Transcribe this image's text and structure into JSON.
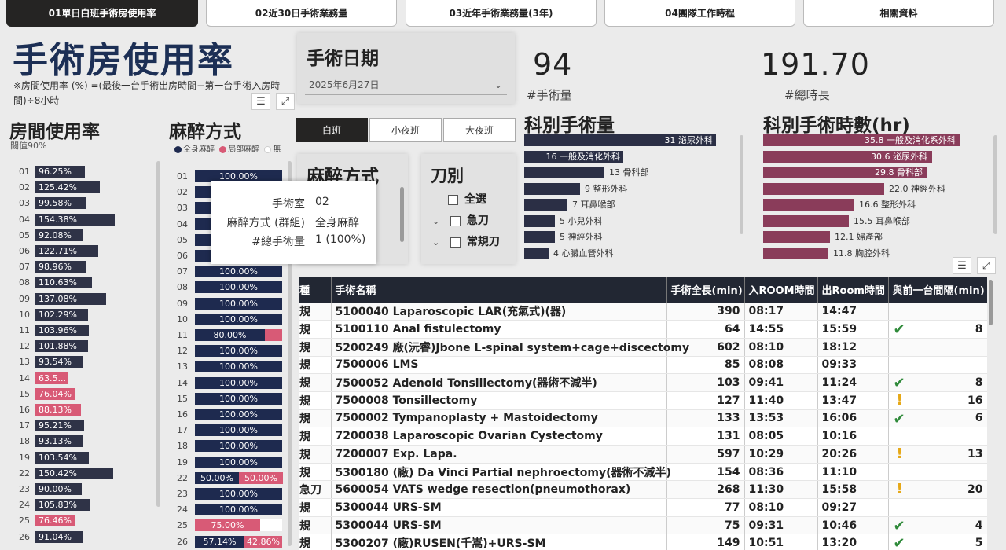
{
  "tabs": [
    {
      "label": "01單日白班手術房使用率",
      "active": true
    },
    {
      "label": "02近30日手術業務量",
      "active": false
    },
    {
      "label": "03近年手術業務量(3年)",
      "active": false
    },
    {
      "label": "04團隊工作時程",
      "active": false
    },
    {
      "label": "相關資料",
      "active": false
    }
  ],
  "page_title": "手術房使用率",
  "formula_note": "※房間使用率 (%) =(最後一台手術出房時間−第一台手術入房時間)÷8小時",
  "room_usage": {
    "title": "房間使用率",
    "threshold": "閾值90%",
    "rows": [
      {
        "room": "01",
        "value": "96.25%",
        "pct": 96.25
      },
      {
        "room": "02",
        "value": "125.42%",
        "pct": 125.42
      },
      {
        "room": "03",
        "value": "99.58%",
        "pct": 99.58
      },
      {
        "room": "04",
        "value": "154.38%",
        "pct": 154.38
      },
      {
        "room": "05",
        "value": "92.08%",
        "pct": 92.08
      },
      {
        "room": "06",
        "value": "122.71%",
        "pct": 122.71
      },
      {
        "room": "07",
        "value": "98.96%",
        "pct": 98.96
      },
      {
        "room": "08",
        "value": "110.63%",
        "pct": 110.63
      },
      {
        "room": "09",
        "value": "137.08%",
        "pct": 137.08
      },
      {
        "room": "10",
        "value": "102.29%",
        "pct": 102.29
      },
      {
        "room": "11",
        "value": "103.96%",
        "pct": 103.96
      },
      {
        "room": "12",
        "value": "101.88%",
        "pct": 101.88
      },
      {
        "room": "13",
        "value": "93.54%",
        "pct": 93.54
      },
      {
        "room": "14",
        "value": "63.5...",
        "pct": 63.5
      },
      {
        "room": "15",
        "value": "76.04%",
        "pct": 76.04
      },
      {
        "room": "16",
        "value": "88.13%",
        "pct": 88.13
      },
      {
        "room": "17",
        "value": "95.21%",
        "pct": 95.21
      },
      {
        "room": "18",
        "value": "93.13%",
        "pct": 93.13
      },
      {
        "room": "19",
        "value": "103.54%",
        "pct": 103.54
      },
      {
        "room": "22",
        "value": "150.42%",
        "pct": 150.42
      },
      {
        "room": "23",
        "value": "90.00%",
        "pct": 90.0
      },
      {
        "room": "24",
        "value": "105.83%",
        "pct": 105.83
      },
      {
        "room": "25",
        "value": "76.46%",
        "pct": 76.46
      },
      {
        "room": "26",
        "value": "91.04%",
        "pct": 91.04
      }
    ]
  },
  "anesthesia": {
    "title": "麻醉方式",
    "legend": [
      {
        "label": "全身麻醉",
        "color": "#1e2a4f"
      },
      {
        "label": "局部麻醉",
        "color": "#d85a76"
      },
      {
        "label": "無",
        "color": "#ffffff"
      }
    ],
    "rows": [
      {
        "room": "01",
        "general": 100,
        "local": 0,
        "general_label": "100.00%",
        "local_label": ""
      },
      {
        "room": "02",
        "general": 100,
        "local": 0,
        "general_label": "100.00%",
        "local_label": ""
      },
      {
        "room": "03",
        "general": 100,
        "local": 0,
        "general_label": "100.00%",
        "local_label": ""
      },
      {
        "room": "04",
        "general": 100,
        "local": 0,
        "general_label": "100.00%",
        "local_label": ""
      },
      {
        "room": "05",
        "general": 100,
        "local": 0,
        "general_label": "100.00%",
        "local_label": ""
      },
      {
        "room": "06",
        "general": 100,
        "local": 0,
        "general_label": "100.00%",
        "local_label": ""
      },
      {
        "room": "07",
        "general": 100,
        "local": 0,
        "general_label": "100.00%",
        "local_label": ""
      },
      {
        "room": "08",
        "general": 100,
        "local": 0,
        "general_label": "100.00%",
        "local_label": ""
      },
      {
        "room": "09",
        "general": 100,
        "local": 0,
        "general_label": "100.00%",
        "local_label": ""
      },
      {
        "room": "10",
        "general": 100,
        "local": 0,
        "general_label": "100.00%",
        "local_label": ""
      },
      {
        "room": "11",
        "general": 80,
        "local": 20,
        "general_label": "80.00%",
        "local_label": ""
      },
      {
        "room": "12",
        "general": 100,
        "local": 0,
        "general_label": "100.00%",
        "local_label": ""
      },
      {
        "room": "13",
        "general": 100,
        "local": 0,
        "general_label": "100.00%",
        "local_label": ""
      },
      {
        "room": "14",
        "general": 100,
        "local": 0,
        "general_label": "100.00%",
        "local_label": ""
      },
      {
        "room": "15",
        "general": 100,
        "local": 0,
        "general_label": "100.00%",
        "local_label": ""
      },
      {
        "room": "16",
        "general": 100,
        "local": 0,
        "general_label": "100.00%",
        "local_label": ""
      },
      {
        "room": "17",
        "general": 100,
        "local": 0,
        "general_label": "100.00%",
        "local_label": ""
      },
      {
        "room": "18",
        "general": 100,
        "local": 0,
        "general_label": "100.00%",
        "local_label": ""
      },
      {
        "room": "19",
        "general": 100,
        "local": 0,
        "general_label": "100.00%",
        "local_label": ""
      },
      {
        "room": "22",
        "general": 50,
        "local": 50,
        "general_label": "50.00%",
        "local_label": "50.00%"
      },
      {
        "room": "23",
        "general": 100,
        "local": 0,
        "general_label": "100.00%",
        "local_label": ""
      },
      {
        "room": "24",
        "general": 100,
        "local": 0,
        "general_label": "100.00%",
        "local_label": ""
      },
      {
        "room": "25",
        "general": 0,
        "local": 75,
        "general_label": "",
        "local_label": "75.00%"
      },
      {
        "room": "26",
        "general": 57.14,
        "local": 42.86,
        "general_label": "57.14%",
        "local_label": "42.86%"
      }
    ]
  },
  "tooltip": {
    "rows": [
      {
        "key": "手術室",
        "value": "02"
      },
      {
        "key": "麻醉方式 (群組)",
        "value": "全身麻醉"
      },
      {
        "key": "#總手術量",
        "value": "1 (100%)"
      }
    ]
  },
  "date_filter": {
    "title": "手術日期",
    "value": "2025年6月27日"
  },
  "shift_buttons": [
    {
      "label": "白班",
      "active": true
    },
    {
      "label": "小夜班",
      "active": false
    },
    {
      "label": "大夜班",
      "active": false
    }
  ],
  "anesthesia_filter": {
    "title": "麻醉方式"
  },
  "knife_filter": {
    "title": "刀別",
    "options": [
      "全選",
      "急刀",
      "常規刀"
    ]
  },
  "kpis": [
    {
      "value": "94",
      "label": "#手術量"
    },
    {
      "value": "191.70",
      "label": "#總時長"
    }
  ],
  "dept_count": {
    "title": "科別手術量",
    "max": 31,
    "rows": [
      {
        "value": 31,
        "label": "泌尿外科"
      },
      {
        "value": 16,
        "label": "一般及消化外科"
      },
      {
        "value": 13,
        "label": "骨科部"
      },
      {
        "value": 9,
        "label": "整形外科"
      },
      {
        "value": 7,
        "label": "耳鼻喉部"
      },
      {
        "value": 5,
        "label": "小兒外科"
      },
      {
        "value": 5,
        "label": "神經外科"
      },
      {
        "value": 4,
        "label": "心臟血管外科"
      }
    ]
  },
  "dept_hours": {
    "title": "科別手術時數(hr)",
    "max": 35.8,
    "rows": [
      {
        "value": 35.8,
        "label": "一般及消化系外科"
      },
      {
        "value": 30.6,
        "label": "泌尿外科"
      },
      {
        "value": 29.8,
        "label": "骨科部"
      },
      {
        "value": 22.0,
        "label": "神經外科"
      },
      {
        "value": 16.6,
        "label": "整形外科"
      },
      {
        "value": 15.5,
        "label": "耳鼻喉部"
      },
      {
        "value": 12.1,
        "label": "婦產部"
      },
      {
        "value": 11.8,
        "label": "胸腔外科"
      }
    ]
  },
  "table": {
    "columns": [
      "種",
      "手術名稱",
      "手術全長(min)",
      "入ROOM時間",
      "出Room時間",
      "與前一台間隔(min)"
    ],
    "rows": [
      {
        "type": "規",
        "name": "5100040 Laparoscopic LAR(充氣式)(器)",
        "len": "390",
        "in": "08:17",
        "out": "14:47",
        "status": "",
        "gap": ""
      },
      {
        "type": "規",
        "name": "5100110 Anal fistulectomy",
        "len": "64",
        "in": "14:55",
        "out": "15:59",
        "status": "check",
        "gap": "8"
      },
      {
        "type": "規",
        "name": "5200249 廠(沅睿)Jbone L-spinal system+cage+discectomy",
        "len": "602",
        "in": "08:10",
        "out": "18:12",
        "status": "",
        "gap": ""
      },
      {
        "type": "規",
        "name": "7500006 LMS",
        "len": "85",
        "in": "08:08",
        "out": "09:33",
        "status": "",
        "gap": ""
      },
      {
        "type": "規",
        "name": "7500052 Adenoid Tonsillectomy(器術不減半)",
        "len": "103",
        "in": "09:41",
        "out": "11:24",
        "status": "check",
        "gap": "8"
      },
      {
        "type": "規",
        "name": "7500008 Tonsillectomy",
        "len": "127",
        "in": "11:40",
        "out": "13:47",
        "status": "warn",
        "gap": "16"
      },
      {
        "type": "規",
        "name": "7500002 Tympanoplasty + Mastoidectomy",
        "len": "133",
        "in": "13:53",
        "out": "16:06",
        "status": "check",
        "gap": "6"
      },
      {
        "type": "規",
        "name": "7200038 Laparoscopic Ovarian Cystectomy",
        "len": "131",
        "in": "08:05",
        "out": "10:16",
        "status": "",
        "gap": ""
      },
      {
        "type": "規",
        "name": "7200007 Exp. Lapa.",
        "len": "597",
        "in": "10:29",
        "out": "20:26",
        "status": "warn",
        "gap": "13"
      },
      {
        "type": "規",
        "name": "5300180 (廠) Da Vinci Partial nephroectomy(器術不減半)",
        "len": "154",
        "in": "08:36",
        "out": "11:10",
        "status": "",
        "gap": ""
      },
      {
        "type": "急刀",
        "name": "5600054 VATS wedge resection(pneumothorax)",
        "len": "268",
        "in": "11:30",
        "out": "15:58",
        "status": "warn",
        "gap": "20"
      },
      {
        "type": "規",
        "name": "5300044 URS-SM",
        "len": "77",
        "in": "08:10",
        "out": "09:27",
        "status": "",
        "gap": ""
      },
      {
        "type": "規",
        "name": "5300044 URS-SM",
        "len": "75",
        "in": "09:31",
        "out": "10:46",
        "status": "check",
        "gap": "4"
      },
      {
        "type": "規",
        "name": "5300207 (廠)RUSEN(千嵩)+URS-SM",
        "len": "149",
        "in": "10:51",
        "out": "13:20",
        "status": "check",
        "gap": "5"
      }
    ]
  }
}
